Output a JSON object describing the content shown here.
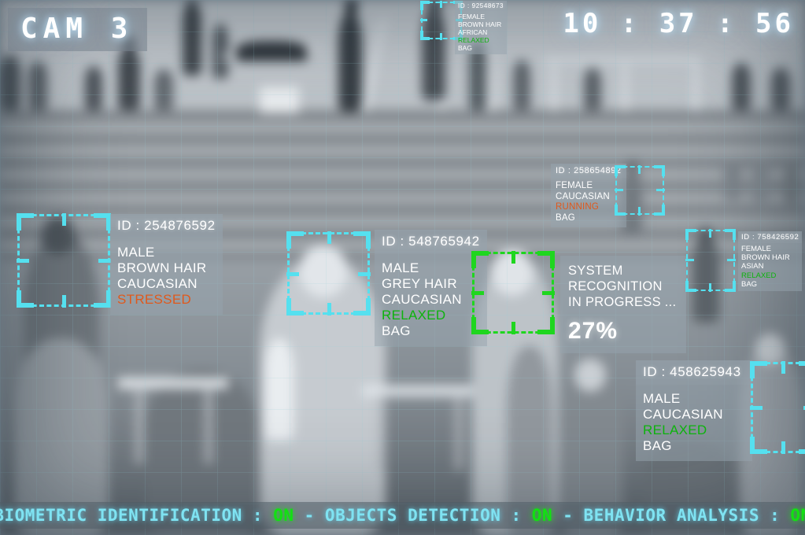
{
  "camera": {
    "label": "CAM 3",
    "timestamp": "10 : 37 : 56"
  },
  "colors": {
    "cyan": "#55e0ef",
    "green": "#1fd61f",
    "relaxed": "#0db30d",
    "alert": "#e0591c",
    "status_on": "#12e012",
    "status_text": "#7fe3f2"
  },
  "detections": [
    {
      "id_label": "ID : 92548673",
      "attributes": [
        "FEMALE",
        "BROWN HAIR",
        "AFRICAN"
      ],
      "behavior": "RELAXED",
      "object": "BAG"
    },
    {
      "id_label": "ID : 258654892",
      "attributes": [
        "FEMALE",
        "CAUCASIAN"
      ],
      "behavior": "RUNNING",
      "object": "BAG"
    },
    {
      "id_label": "ID : 254876592",
      "attributes": [
        "MALE",
        "BROWN HAIR",
        "CAUCASIAN"
      ],
      "behavior": "STRESSED",
      "object": ""
    },
    {
      "id_label": "ID : 548765942",
      "attributes": [
        "MALE",
        "GREY HAIR",
        "CAUCASIAN"
      ],
      "behavior": "RELAXED",
      "object": "BAG"
    },
    {
      "id_label": "ID : 758426592",
      "attributes": [
        "FEMALE",
        "BROWN HAIR",
        "ASIAN"
      ],
      "behavior": "RELAXED",
      "object": "BAG"
    },
    {
      "id_label": "ID : 458625943",
      "attributes": [
        "MALE",
        "CAUCASIAN"
      ],
      "behavior": "RELAXED",
      "object": "BAG"
    }
  ],
  "system_recognition": {
    "line1": "SYSTEM",
    "line2": "RECOGNITION",
    "line3": "IN PROGRESS ...",
    "percent": "27%"
  },
  "status_bar": {
    "biometric_label": "BIOMETRIC IDENTIFICATION : ",
    "biometric_value": "ON",
    "sep1": "  -  ",
    "objects_label": "OBJECTS DETECTION : ",
    "objects_value": "ON",
    "sep2": "  -  ",
    "behavior_label": "BEHAVIOR ANALYSIS  : ",
    "behavior_value": "ON"
  }
}
